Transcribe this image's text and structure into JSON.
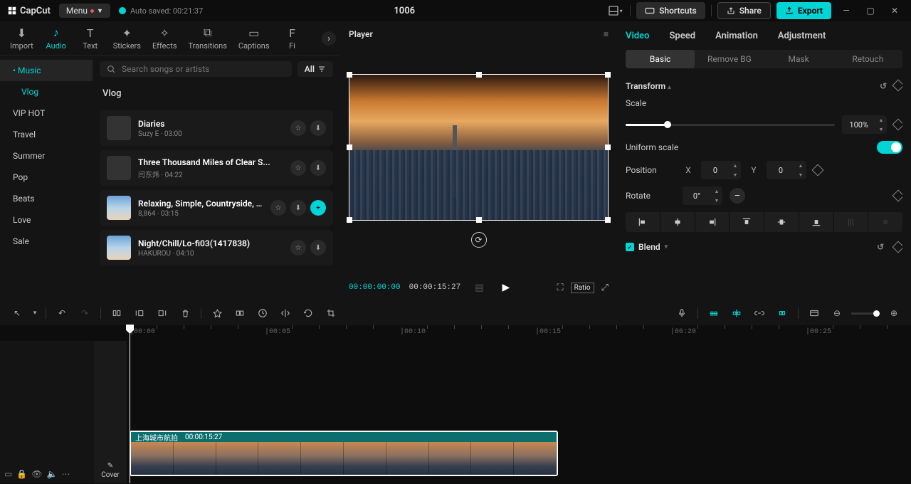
{
  "titlebar": {
    "brand": "CapCut",
    "menu": "Menu",
    "autosaved": "Auto saved: 00:21:37",
    "project_name": "1006",
    "shortcuts": "Shortcuts",
    "share": "Share",
    "export": "Export"
  },
  "tabs": [
    "Import",
    "Audio",
    "Text",
    "Stickers",
    "Effects",
    "Transitions",
    "Captions",
    "Fi"
  ],
  "tabs_active_index": 1,
  "audio": {
    "search_placeholder": "Search songs or artists",
    "filter_label": "All",
    "categories": [
      "Music",
      "Vlog",
      "VIP HOT",
      "Travel",
      "Summer",
      "Pop",
      "Beats",
      "Love",
      "Sale"
    ],
    "cat_active_index": 0,
    "cat_sub_index": 1,
    "section_label": "Vlog",
    "tracks": [
      {
        "title": "Diaries",
        "sub": "Suzy E · 03:00",
        "thumb": false,
        "add": false
      },
      {
        "title": "Three Thousand Miles of Clear S...",
        "sub": "闫东炜 · 04:22",
        "thumb": false,
        "add": false
      },
      {
        "title": "Relaxing, Simple, Countryside, Tr...",
        "sub": "8,864 · 03:15",
        "thumb": true,
        "add": true
      },
      {
        "title": "Night/Chill/Lo-fi03(1417838)",
        "sub": "HAKUROU · 04:10",
        "thumb": true,
        "add": false
      }
    ]
  },
  "player": {
    "title": "Player",
    "time_current": "00:00:00:00",
    "time_duration": "00:00:15:27",
    "ratio_label": "Ratio"
  },
  "inspector": {
    "tabs": [
      "Video",
      "Speed",
      "Animation",
      "Adjustment"
    ],
    "tabs_active_index": 0,
    "subtabs": [
      "Basic",
      "Remove BG",
      "Mask",
      "Retouch"
    ],
    "subtabs_active_index": 0,
    "transform_label": "Transform",
    "scale_label": "Scale",
    "scale_value": "100%",
    "scale_pct": 20,
    "uniform_label": "Uniform scale",
    "position_label": "Position",
    "pos_x_label": "X",
    "pos_x_value": "0",
    "pos_y_label": "Y",
    "pos_y_value": "0",
    "rotate_label": "Rotate",
    "rotate_value": "0°",
    "blend_label": "Blend"
  },
  "timeline": {
    "ruler_marks": [
      "00:00",
      "00:05",
      "00:10",
      "00:15",
      "00:20",
      "00:25"
    ],
    "clip_name": "上海城市航拍",
    "clip_duration": "00:00:15:27",
    "cover_label": "Cover"
  }
}
